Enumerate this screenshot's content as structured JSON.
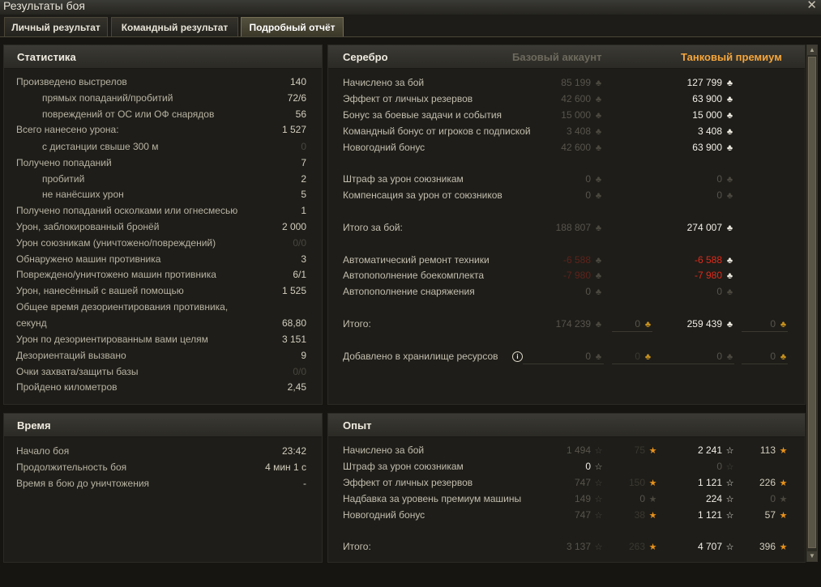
{
  "window": {
    "title": "Результаты боя",
    "close_icon": "close-icon"
  },
  "tabs": [
    {
      "label": "Личный результат"
    },
    {
      "label": "Командный результат"
    },
    {
      "label": "Подробный отчёт"
    }
  ],
  "statistics": {
    "title": "Статистика",
    "rows": [
      {
        "label": "Произведено выстрелов",
        "value": "140"
      },
      {
        "label": "прямых попаданий/пробитий",
        "value": "72/6"
      },
      {
        "label": "повреждений от ОС или ОФ снарядов",
        "value": "56"
      },
      {
        "label": "Всего нанесено урона:",
        "value": "1 527"
      },
      {
        "label": "с дистанции свыше 300 м",
        "value": "0"
      },
      {
        "label": "Получено попаданий",
        "value": "7"
      },
      {
        "label": "пробитий",
        "value": "2"
      },
      {
        "label": "не нанёсших урон",
        "value": "5"
      },
      {
        "label": "Получено попаданий осколками или огнесмесью",
        "value": "1"
      },
      {
        "label": "Урон, заблокированный бронёй",
        "value": "2 000"
      },
      {
        "label": "Урон союзникам (уничтожено/повреждений)",
        "value": "0/0"
      },
      {
        "label": "Обнаружено машин противника",
        "value": "3"
      },
      {
        "label": "Повреждено/уничтожено машин противника",
        "value": "6/1"
      },
      {
        "label": "Урон, нанесённый с вашей помощью",
        "value": "1 525"
      },
      {
        "label": "Общее время дезориентирования противника,",
        "value": ""
      },
      {
        "label": "секунд",
        "value": "68,80"
      },
      {
        "label": "Урон по дезориентированным вами целям",
        "value": "3 151"
      },
      {
        "label": "Дезориентаций вызвано",
        "value": "9"
      },
      {
        "label": "Очки захвата/защиты базы",
        "value": "0/0"
      },
      {
        "label": "Пройдено километров",
        "value": "2,45"
      }
    ]
  },
  "time": {
    "title": "Время",
    "rows": [
      {
        "label": "Начало боя",
        "value": "23:42"
      },
      {
        "label": "Продолжительность боя",
        "value": "4 мин 1 с"
      },
      {
        "label": "Время в бою до уничтожения",
        "value": "-"
      }
    ]
  },
  "silver": {
    "title": "Серебро",
    "col_base": "Базовый аккаунт",
    "col_premium": "Танковый премиум",
    "info_icon": "i",
    "rows": [
      {
        "label": "Начислено за бой",
        "base": "85 199",
        "premium": "127 799"
      },
      {
        "label": "Эффект от личных резервов",
        "base": "42 600",
        "premium": "63 900"
      },
      {
        "label": "Бонус за боевые задачи и события",
        "base": "15 000",
        "premium": "15 000"
      },
      {
        "label": "Командный бонус от игроков с подпиской",
        "base": "3 408",
        "premium": "3 408"
      },
      {
        "label": "Новогодний бонус",
        "base": "42 600",
        "premium": "63 900"
      },
      {
        "label": "Штраф за урон союзникам",
        "base": "0",
        "premium": "0"
      },
      {
        "label": "Компенсация за урон от союзников",
        "base": "0",
        "premium": "0"
      },
      {
        "label": "Итого за бой:",
        "base": "188 807",
        "premium": "274 007"
      },
      {
        "label": "Автоматический ремонт техники",
        "base": "-6 588",
        "premium": "-6 588"
      },
      {
        "label": "Автопополнение боекомплекта",
        "base": "-7 980",
        "premium": "-7 980"
      },
      {
        "label": "Автопополнение снаряжения",
        "base": "0",
        "premium": "0"
      },
      {
        "label": "Итого:",
        "base": "174 239",
        "base_gold": "0",
        "premium": "259 439",
        "premium_gold": "0"
      },
      {
        "label": "Добавлено в хранилище ресурсов",
        "base": "0",
        "base_gold": "0",
        "premium": "0",
        "premium_gold": "0"
      }
    ]
  },
  "experience": {
    "title": "Опыт",
    "rows": [
      {
        "label": "Начислено за бой",
        "base": "1 494",
        "base_free": "75",
        "premium": "2 241",
        "premium_free": "113"
      },
      {
        "label": "Штраф за урон союзникам",
        "base": "0",
        "base_free": "",
        "premium": "0",
        "premium_free": ""
      },
      {
        "label": "Эффект от личных резервов",
        "base": "747",
        "base_free": "150",
        "premium": "1 121",
        "premium_free": "226"
      },
      {
        "label": "Надбавка за уровень премиум машины",
        "base": "149",
        "base_free": "0",
        "premium": "224",
        "premium_free": "0"
      },
      {
        "label": "Новогодний бонус",
        "base": "747",
        "base_free": "38",
        "premium": "1 121",
        "premium_free": "57"
      },
      {
        "label": "Итого:",
        "base": "3 137",
        "base_free": "263",
        "premium": "4 707",
        "premium_free": "396"
      }
    ]
  },
  "icons": {
    "credit": "♣",
    "star": "☆",
    "gold_star": "★",
    "scroll_up": "▲",
    "scroll_down": "▼"
  }
}
